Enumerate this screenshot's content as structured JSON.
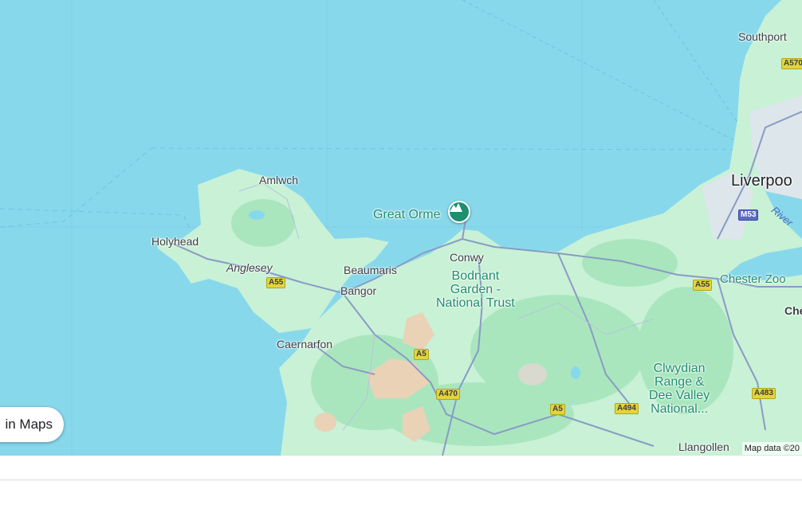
{
  "map": {
    "colors": {
      "sea": "#88d8ec",
      "land": "#c8f1d6",
      "forest": "#a9e6be",
      "hills": "#e9d2b6",
      "road": "#8a9bc4",
      "pin": "#1e8e6e"
    },
    "places": {
      "southport": "Southport",
      "liverpool": "Liverpoo",
      "amlwch": "Amlwch",
      "holyhead": "Holyhead",
      "anglesey": "Anglesey",
      "beaumaris": "Beaumaris",
      "bangor": "Bangor",
      "conwy": "Conwy",
      "caernarfon": "Caernarfon",
      "chester_zoo": "Chester Zoo",
      "che": "Che",
      "llangollen": "Llangollen"
    },
    "poi": {
      "great_orme": "Great Orme",
      "bodnant": "Bodnant Garden - National Trust",
      "clwydian": "Clwydian Range & Dee Valley National..."
    },
    "poi_lines": {
      "bodnant": [
        "Bodnant",
        "Garden -",
        "National Trust"
      ],
      "clwydian": [
        "Clwydian",
        "Range &",
        "Dee Valley",
        "National..."
      ]
    },
    "river": "River",
    "roads": {
      "a55_west": "A55",
      "a55_east": "A55",
      "a5_north": "A5",
      "a5_south": "A5",
      "a470": "A470",
      "a494": "A494",
      "a483": "A483",
      "a570": "A570",
      "m53": "M53"
    },
    "pin_icon": "mountain-icon",
    "attribution": "Map data ©20"
  },
  "controls": {
    "open_in_maps": "in Maps"
  }
}
